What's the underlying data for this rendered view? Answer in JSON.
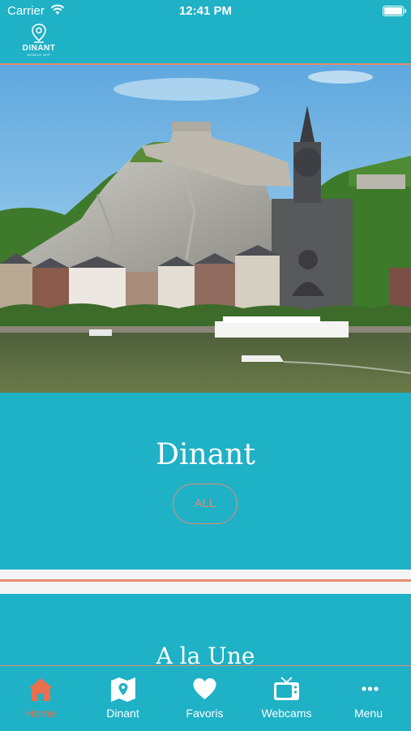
{
  "status_bar": {
    "carrier": "Carrier",
    "time": "12:41 PM"
  },
  "header": {
    "logo_name": "DINANT",
    "logo_sub": "MOBILE APP"
  },
  "city": {
    "title": "Dinant",
    "filter_button": "ALL"
  },
  "featured": {
    "title": "A la Une"
  },
  "tabs": [
    {
      "label": "Home",
      "icon": "home-icon",
      "active": true
    },
    {
      "label": "Dinant",
      "icon": "map-icon",
      "active": false
    },
    {
      "label": "Favoris",
      "icon": "heart-icon",
      "active": false
    },
    {
      "label": "Webcams",
      "icon": "tv-icon",
      "active": false
    },
    {
      "label": "Menu",
      "icon": "more-icon",
      "active": false
    }
  ],
  "colors": {
    "primary": "#1fb1c6",
    "accent": "#e58b6f",
    "active_tab": "#e8704f"
  }
}
